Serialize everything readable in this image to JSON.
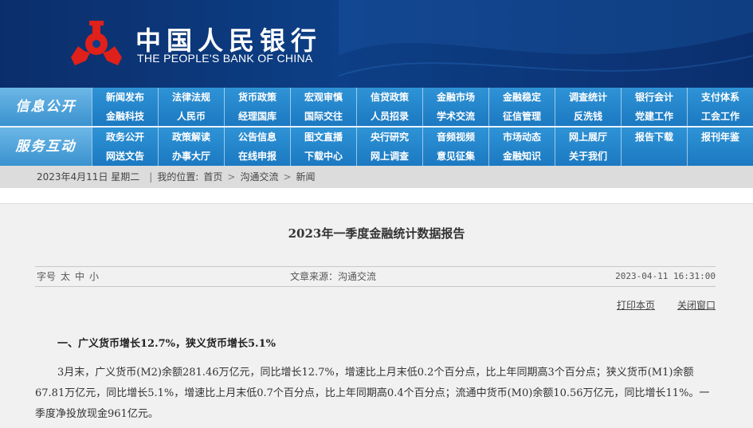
{
  "header": {
    "title_cn": "中国人民银行",
    "title_en": "THE PEOPLE'S BANK OF CHINA",
    "brand_color": "#0d3f86",
    "emblem_color": "#e0201a"
  },
  "nav": {
    "row1_label": "信息公开",
    "row1_items": [
      "新闻发布",
      "法律法规",
      "货币政策",
      "宏观审慎",
      "信贷政策",
      "金融市场",
      "金融稳定",
      "调查统计",
      "银行会计",
      "支付体系",
      "金融科技",
      "人民币",
      "经理国库",
      "国际交往",
      "人员招录",
      "学术交流",
      "征信管理",
      "反洗钱",
      "党建工作",
      "工会工作"
    ],
    "row2_label": "服务互动",
    "row2_items": [
      "政务公开",
      "政策解读",
      "公告信息",
      "图文直播",
      "央行研究",
      "音频视频",
      "市场动态",
      "网上展厅",
      "报告下载",
      "报刊年鉴",
      "网送文告",
      "办事大厅",
      "在线申报",
      "下载中心",
      "网上调查",
      "意见征集",
      "金融知识",
      "关于我们",
      "",
      ""
    ]
  },
  "breadcrumb": {
    "date": "2023年4月11日 星期二",
    "location_label": "我的位置:",
    "home": "首页",
    "section": "沟通交流",
    "page": "新闻"
  },
  "article": {
    "title": "2023年一季度金融统计数据报告",
    "font_size_label": "字号",
    "font_sizes": [
      "太",
      "中",
      "小"
    ],
    "source": "文章来源：沟通交流",
    "datetime": "2023-04-11 16:31:00",
    "print_label": "打印本页",
    "close_label": "关闭窗口",
    "heading1": "一、广义货币增长12.7%，狭义货币增长5.1%",
    "paragraph1": "3月末，广义货币(M2)余额281.46万亿元，同比增长12.7%，增速比上月末低0.2个百分点，比上年同期高3个百分点；狭义货币(M1)余额67.81万亿元，同比增长5.1%，增速比上月末低0.7个百分点，比上年同期高0.4个百分点；流通中货币(M0)余额10.56万亿元，同比增长11%。一季度净投放现金961亿元。"
  }
}
